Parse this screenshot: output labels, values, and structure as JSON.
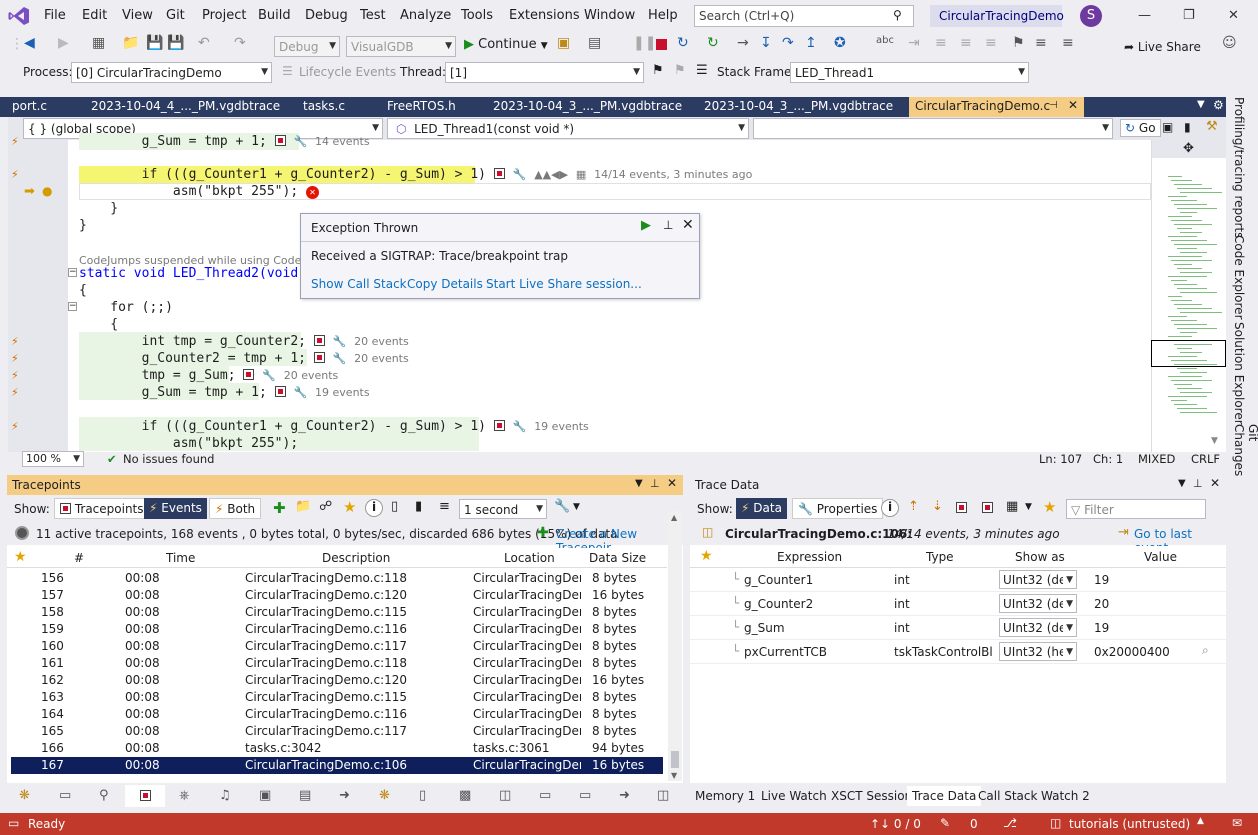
{
  "menu": {
    "items": [
      "File",
      "Edit",
      "View",
      "Git",
      "Project",
      "Build",
      "Debug",
      "Test",
      "Analyze",
      "Tools",
      "Extensions",
      "Window",
      "Help"
    ],
    "search_placeholder": "Search (Ctrl+Q)",
    "solution_name": "CircularTracingDemo",
    "avatar_letter": "S"
  },
  "toolbar": {
    "config": "Debug",
    "platform": "VisualGDB",
    "continue_label": "Continue",
    "live_share_label": "Live Share",
    "process_label": "Process:",
    "process_value": "[0] CircularTracingDemo",
    "lifecycle_label": "Lifecycle Events",
    "thread_label": "Thread:",
    "thread_value": "[1]",
    "stack_frame_label": "Stack Frame:",
    "stack_frame_value": "LED_Thread1"
  },
  "doc_tabs": [
    {
      "label": "port.c"
    },
    {
      "label": "2023-10-04_4_..._PM.vgdbtrace"
    },
    {
      "label": "tasks.c"
    },
    {
      "label": "FreeRTOS.h"
    },
    {
      "label": "2023-10-04_3_..._PM.vgdbtrace"
    },
    {
      "label": "2023-10-04_3_..._PM.vgdbtrace"
    },
    {
      "label": "CircularTracingDemo.c"
    }
  ],
  "navbar": {
    "scope": "{ }   (global scope)",
    "function": "LED_Thread1(const void *)",
    "go_label": "Go"
  },
  "editor": {
    "lines": {
      "l1": "        g_Sum = tmp + 1;",
      "l1_hint": "14 events",
      "l2": "        if (((g_Counter1 + g_Counter2) - g_Sum) > 1)",
      "l2_hint": "14/14 events, 3 minutes ago",
      "l3": "            asm(\"bkpt 255\");",
      "l4": "    }",
      "l5": "}",
      "codejump_hint": "CodeJumps suspended while using Code Expl",
      "l6": "static void LED_Thread2(void",
      "l7": "{",
      "l8": "    for (;;)",
      "l9": "    {",
      "l10": "        int tmp = g_Counter2;",
      "l10_hint": "20 events",
      "l11": "        g_Counter2 = tmp + 1;",
      "l11_hint": "20 events",
      "l12": "        tmp = g_Sum;",
      "l12_hint": "20 events",
      "l13": "        g_Sum = tmp + 1;",
      "l13_hint": "19 events",
      "l14": "        if (((g_Counter1 + g_Counter2) - g_Sum) > 1)",
      "l14_hint": "19 events",
      "l15": "            asm(\"bkpt 255\");"
    },
    "zoom": "100 %",
    "issues": "No issues found",
    "ln": "Ln: 107",
    "ch": "Ch: 1",
    "mode": "MIXED",
    "eol": "CRLF"
  },
  "popup": {
    "title": "Exception Thrown",
    "message": "Received a SIGTRAP: Trace/breakpoint trap",
    "link1": "Show Call Stack",
    "link2": "Copy Details",
    "link3": "Start Live Share session..."
  },
  "side_tabs": [
    "Profiling/tracing reports",
    "Code Explorer",
    "Solution Explorer",
    "Git Changes"
  ],
  "tracepoints": {
    "title": "Tracepoints",
    "show_label": "Show:",
    "btn_tracepoints": "Tracepoints",
    "btn_events": "Events",
    "btn_both": "Both",
    "interval": "1 second",
    "summary": "11 active tracepoints, 168 events , 0 bytes total, 0 bytes/sec, discarded 686 bytes (15%) of data",
    "create_link": "Create a New Tracepoir",
    "columns": [
      "#",
      "Time",
      "Description",
      "Location",
      "Data Size"
    ],
    "rows": [
      [
        "156",
        "00:08",
        "CircularTracingDemo.c:118",
        "CircularTracingDemo",
        "8 bytes"
      ],
      [
        "157",
        "00:08",
        "CircularTracingDemo.c:120",
        "CircularTracingDemo",
        "16 bytes"
      ],
      [
        "158",
        "00:08",
        "CircularTracingDemo.c:115",
        "CircularTracingDemo",
        "8 bytes"
      ],
      [
        "159",
        "00:08",
        "CircularTracingDemo.c:116",
        "CircularTracingDemo",
        "8 bytes"
      ],
      [
        "160",
        "00:08",
        "CircularTracingDemo.c:117",
        "CircularTracingDemo",
        "8 bytes"
      ],
      [
        "161",
        "00:08",
        "CircularTracingDemo.c:118",
        "CircularTracingDemo",
        "8 bytes"
      ],
      [
        "162",
        "00:08",
        "CircularTracingDemo.c:120",
        "CircularTracingDemo",
        "16 bytes"
      ],
      [
        "163",
        "00:08",
        "CircularTracingDemo.c:115",
        "CircularTracingDemo",
        "8 bytes"
      ],
      [
        "164",
        "00:08",
        "CircularTracingDemo.c:116",
        "CircularTracingDemo",
        "8 bytes"
      ],
      [
        "165",
        "00:08",
        "CircularTracingDemo.c:117",
        "CircularTracingDemo",
        "8 bytes"
      ],
      [
        "166",
        "00:08",
        "tasks.c:3042",
        "tasks.c:3061",
        "94 bytes"
      ],
      [
        "167",
        "00:08",
        "CircularTracingDemo.c:106",
        "CircularTracingDemo",
        "16 bytes"
      ]
    ]
  },
  "trace_data": {
    "title": "Trace Data",
    "show_label": "Show:",
    "btn_data": "Data",
    "btn_properties": "Properties",
    "filter_placeholder": "Filter",
    "location": "CircularTracingDemo.c:106:",
    "location_detail": "14/14 events, 3 minutes ago",
    "goto_last": "Go to last event",
    "columns": [
      "Expression",
      "Type",
      "Show as",
      "Value"
    ],
    "rows": [
      [
        "g_Counter1",
        "int",
        "UInt32 (dec)",
        "19"
      ],
      [
        "g_Counter2",
        "int",
        "UInt32 (dec)",
        "20"
      ],
      [
        "g_Sum",
        "int",
        "UInt32 (dec)",
        "19"
      ],
      [
        "pxCurrentTCB",
        "tskTaskControlBl",
        "UInt32 (hex)",
        "0x20000400"
      ]
    ]
  },
  "bottom_tabs": [
    "Memory 1",
    "Live Watch",
    "XSCT Session",
    "Trace Data",
    "Call Stack",
    "Watch 2"
  ],
  "status": {
    "ready": "Ready",
    "git_sync": "↑↓ 0 / 0",
    "pencil_count": "0",
    "repo": "tutorials (untrusted)"
  },
  "colors": {
    "accent_tab": "#f5cc84",
    "doc_tab_bar": "#2b3b61",
    "status_bar": "#c0392b",
    "selected_row": "#0e1f5b"
  }
}
